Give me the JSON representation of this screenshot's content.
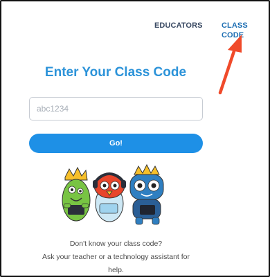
{
  "nav": {
    "educators_label": "EDUCATORS",
    "class_code_label": "CLASS CODE"
  },
  "main": {
    "title": "Enter Your Class Code",
    "code_input": {
      "value": "",
      "placeholder": "abc1234"
    },
    "go_label": "Go!",
    "help_line_1": "Don't know your class code?",
    "help_line_2": "Ask your teacher or a technology assistant for",
    "help_line_3": "help."
  },
  "colors": {
    "accent_blue": "#1e90e6",
    "title_blue": "#2c93d9",
    "annotation_arrow": "#f04a2a",
    "nav_dark": "#3a4a63"
  },
  "icons": {
    "annotation": "red-arrow-icon",
    "illustration": "mascot-characters"
  }
}
